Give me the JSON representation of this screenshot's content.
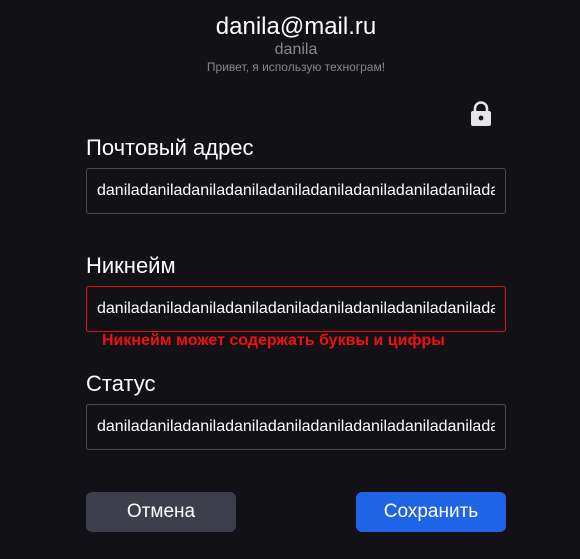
{
  "profile": {
    "email": "danila@mail.ru",
    "nickname": "danila",
    "status": "Привет, я использую техногрaм!"
  },
  "lock": {
    "icon": "lock-icon",
    "color": "#e6e6e6"
  },
  "form": {
    "email": {
      "label": "Почтовый адрес",
      "value": "daniladaniladaniladaniladaniladaniladaniladaniladanilada"
    },
    "nickname": {
      "label": "Никнейм",
      "value": "daniladaniladaniladaniladaniladaniladaniladaniladanilada",
      "error": "Никнейм может содержать буквы и цифры"
    },
    "status": {
      "label": "Статус",
      "value": "daniladaniladaniladaniladaniladaniladaniladaniladanilada"
    }
  },
  "buttons": {
    "cancel": "Отмена",
    "save": "Сохранить"
  },
  "colors": {
    "background": "#111116",
    "accent": "#1f63e6",
    "error": "#ef1111",
    "secondary_button": "#3d3f4d"
  }
}
